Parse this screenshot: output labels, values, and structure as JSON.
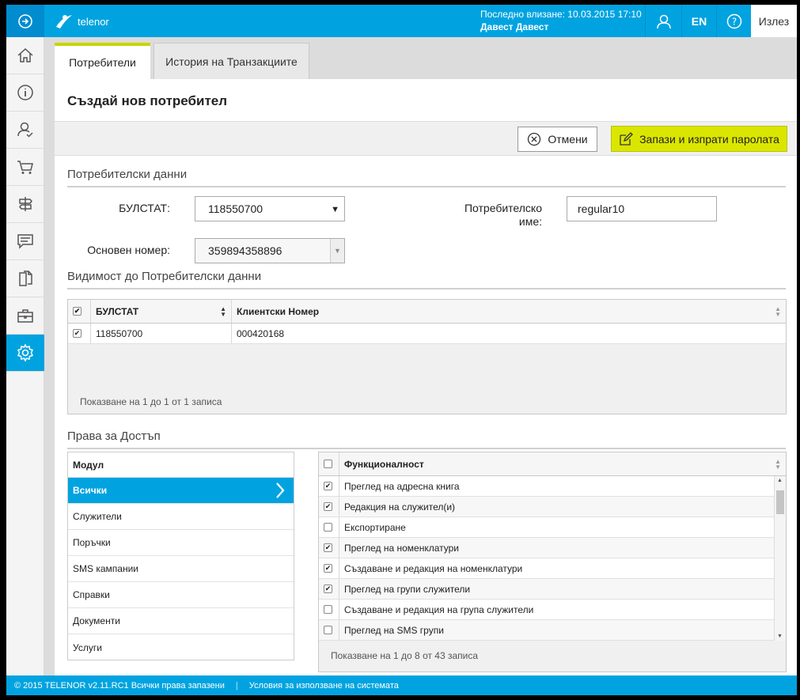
{
  "header": {
    "brand": "telenor",
    "last_login_label": "Последно влизане: 10.03.2015 17:10",
    "user_name": "Давест Давест",
    "lang": "EN",
    "logout": "Излез"
  },
  "sidebar": {
    "items": [
      {
        "icon": "home-icon"
      },
      {
        "icon": "info-icon"
      },
      {
        "icon": "user-check-icon"
      },
      {
        "icon": "cart-icon"
      },
      {
        "icon": "signpost-icon"
      },
      {
        "icon": "message-icon"
      },
      {
        "icon": "documents-icon"
      },
      {
        "icon": "briefcase-icon"
      },
      {
        "icon": "gear-icon",
        "active": true
      }
    ]
  },
  "tabs": [
    {
      "label": "Потребители",
      "active": true
    },
    {
      "label": "История на Транзакциите",
      "active": false
    }
  ],
  "page": {
    "title": "Създай нов потребител",
    "cancel_label": "Отмени",
    "save_label": "Запази и изпрати паролата"
  },
  "user_data": {
    "section_title": "Потребителски данни",
    "bulstat_label": "БУЛСТАТ:",
    "bulstat_value": "118550700",
    "main_number_label": "Основен номер:",
    "main_number_value": "359894358896",
    "username_label_1": "Потребителско",
    "username_label_2": "име:",
    "username_value": "regular10"
  },
  "visibility": {
    "section_title": "Видимост до Потребителски данни",
    "columns": [
      "БУЛСТАТ",
      "Клиентски Номер"
    ],
    "rows": [
      {
        "checked": true,
        "bulstat": "118550700",
        "client_number": "000420168"
      }
    ],
    "footer": "Показване на 1 до 1 от 1 записа"
  },
  "access": {
    "section_title": "Права за Достъп",
    "modules_header": "Модул",
    "modules": [
      "Всички",
      "Служители",
      "Поръчки",
      "SMS кампании",
      "Справки",
      "Документи",
      "Услуги"
    ],
    "active_module": 0,
    "func_header": "Функционалност",
    "functions": [
      {
        "label": "Преглед на адресна книга",
        "checked": true
      },
      {
        "label": "Редакция на служител(и)",
        "checked": true
      },
      {
        "label": "Експортиране",
        "checked": false
      },
      {
        "label": "Преглед на номенклатури",
        "checked": true
      },
      {
        "label": "Създаване и редакция на номенклатури",
        "checked": true
      },
      {
        "label": "Преглед на групи служители",
        "checked": true
      },
      {
        "label": "Създаване и редакция на група служители",
        "checked": false
      },
      {
        "label": "Преглед на SMS групи",
        "checked": false
      }
    ],
    "func_footer": "Показване на 1 до 8 от 43 записа"
  },
  "footer": {
    "copyright": "© 2015 TELENOR v2.11.RC1 Всички права запазени",
    "separator": "|",
    "terms": "Условия за използване на системата"
  },
  "colors": {
    "brand_blue": "#00a3e0",
    "accent_green": "#dbe600"
  }
}
